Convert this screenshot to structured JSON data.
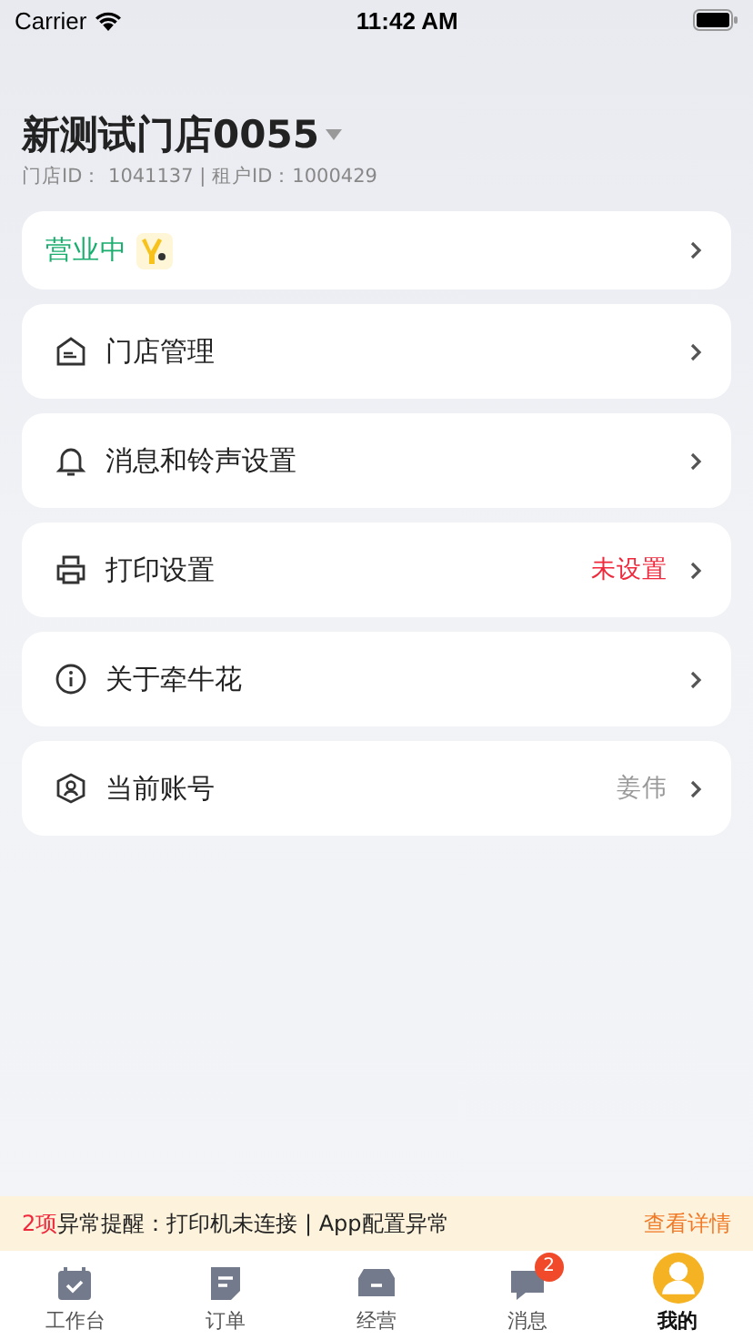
{
  "status_bar": {
    "carrier": "Carrier",
    "time": "11:42 AM"
  },
  "store": {
    "name": "新测试门店0055",
    "ids": "门店ID： 1041137  |  租户ID：1000429"
  },
  "business_status": {
    "label": "营业中",
    "open": true
  },
  "menu": [
    {
      "kind": "store",
      "label": "门店管理"
    },
    {
      "kind": "bell",
      "label": "消息和铃声设置"
    },
    {
      "kind": "printer",
      "label": "打印设置",
      "value": "未设置",
      "alert": true
    },
    {
      "kind": "info",
      "label": "关于牵牛花"
    },
    {
      "kind": "account",
      "label": "当前账号",
      "value": "姜伟",
      "alert": false
    }
  ],
  "alert_bar": {
    "count": "2项",
    "text": "异常提醒：打印机未连接 | App配置异常",
    "link": "查看详情"
  },
  "tabs": [
    {
      "kind": "workbench",
      "label": "工作台",
      "selected": false
    },
    {
      "kind": "orders",
      "label": "订单",
      "selected": false
    },
    {
      "kind": "business",
      "label": "经营",
      "selected": false
    },
    {
      "kind": "messages",
      "label": "消息",
      "selected": false,
      "badge": "2"
    },
    {
      "kind": "mine",
      "label": "我的",
      "selected": true
    }
  ]
}
